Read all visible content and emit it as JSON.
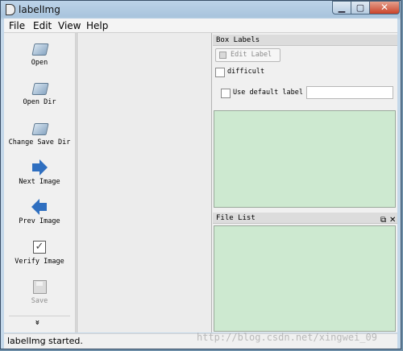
{
  "window": {
    "title": "labelImg",
    "controls": {
      "minimize": "▁",
      "maximize": "▢",
      "close": "✕"
    }
  },
  "menu": {
    "items": [
      "File",
      "Edit",
      "View",
      "Help"
    ]
  },
  "toolbar": {
    "items": [
      {
        "label": "Open",
        "icon": "folder-open-icon"
      },
      {
        "label": "Open Dir",
        "icon": "folder-open-icon"
      },
      {
        "label": "Change Save Dir",
        "icon": "folder-open-icon"
      },
      {
        "label": "Next Image",
        "icon": "arrow-right-icon"
      },
      {
        "label": "Prev Image",
        "icon": "arrow-left-icon"
      },
      {
        "label": "Verify Image",
        "icon": "checkbox-icon"
      },
      {
        "label": "Save",
        "icon": "save-icon",
        "disabled": true
      }
    ],
    "more": "»"
  },
  "box_labels": {
    "title": "Box Labels",
    "edit_label": "Edit Label",
    "difficult": "difficult",
    "use_default_label": "Use default label",
    "default_label_value": ""
  },
  "file_list": {
    "title": "File List",
    "float_icon": "⧉",
    "close_icon": "✕"
  },
  "status": {
    "text": "labelImg started."
  },
  "watermark": "http://blog.csdn.net/xingwei_09",
  "colors": {
    "list_bg": "#cde9d0",
    "icon_blue": "#2f6fc0"
  }
}
